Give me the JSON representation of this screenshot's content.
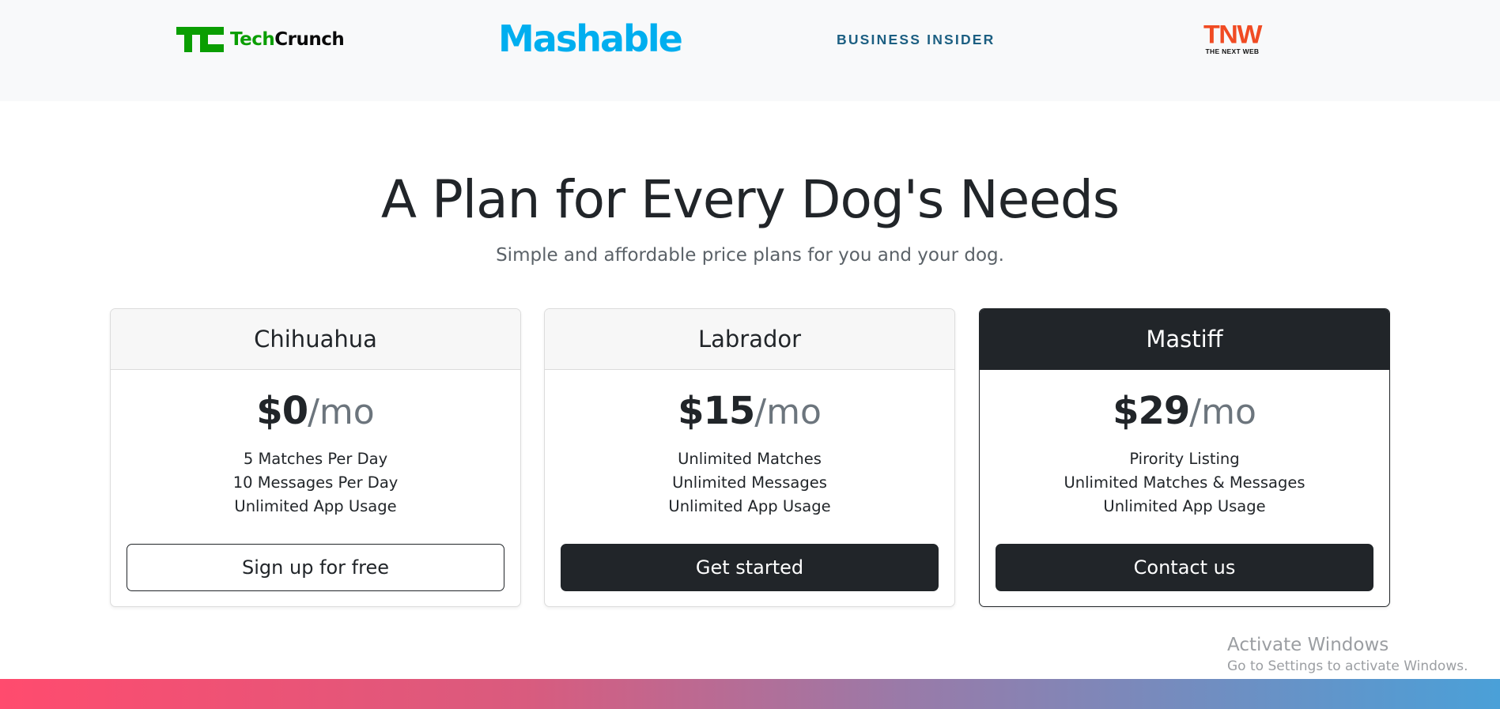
{
  "press": {
    "logos": {
      "techcrunch": {
        "prefix": "Tech",
        "suffix": "Crunch"
      },
      "mashable": "Mashable",
      "business_insider": "BUSINESS INSIDER",
      "tnw": {
        "mark": "TNW",
        "tagline": "THE NEXT WEB"
      }
    }
  },
  "pricing": {
    "title": "A Plan for Every Dog's Needs",
    "subtitle": "Simple and affordable price plans for you and your dog.",
    "plans": [
      {
        "name": "Chihuahua",
        "price": "$0",
        "period": "/mo",
        "features": [
          "5 Matches Per Day",
          "10 Messages Per Day",
          "Unlimited App Usage"
        ],
        "button": "Sign up for free"
      },
      {
        "name": "Labrador",
        "price": "$15",
        "period": "/mo",
        "features": [
          "Unlimited Matches",
          "Unlimited Messages",
          "Unlimited App Usage"
        ],
        "button": "Get started"
      },
      {
        "name": "Mastiff",
        "price": "$29",
        "period": "/mo",
        "features": [
          "Pirority Listing",
          "Unlimited Matches & Messages",
          "Unlimited App Usage"
        ],
        "button": "Contact us"
      }
    ]
  },
  "watermark": {
    "line1": "Activate Windows",
    "line2": "Go to Settings to activate Windows."
  },
  "colors": {
    "brand_dark": "#212529",
    "techcrunch_green": "#0a9e01",
    "mashable_blue": "#00aeef",
    "business_insider_blue": "#1c5f82",
    "tnw_orange": "#f04b23",
    "gradient_start": "#ff4b6e",
    "gradient_end": "#4aa0d8"
  }
}
